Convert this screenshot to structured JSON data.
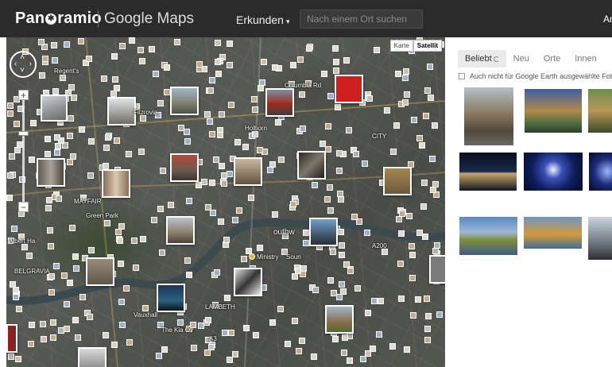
{
  "header": {
    "brand_pre": "Pan",
    "brand_post": "ramio",
    "brand_glyph": "✱",
    "subbrand": "Google Maps",
    "explore_label": "Erkunden",
    "explore_caret": "▾",
    "search_placeholder": "Nach einem Ort suchen",
    "user_stub": "An"
  },
  "map": {
    "type_buttons": [
      "Karte",
      "Satellit"
    ],
    "active_type": "Satellit",
    "zoom_in": "+",
    "zoom_out": "−",
    "pan_glyphs": [
      "‹",
      "›",
      "˄",
      "˅"
    ],
    "labels": [
      "Columbia Rd",
      "Albert Ha",
      "BELGRAVIA",
      "MAYFAIR",
      "outhw",
      "Ministry",
      "Soun",
      "A200",
      "Regent's",
      "CITY",
      "The Kia Ov",
      "A3",
      "Green Park",
      "LAMBETH",
      "Vauxhall",
      "Holborn",
      "Fitzrovia"
    ]
  },
  "panel": {
    "tabs": [
      "Beliebt",
      "Neu",
      "Orte",
      "Innen"
    ],
    "active_tab": "Beliebt",
    "filter_label": "Auch nicht für Google Earth ausgewählte Fotos"
  },
  "colors": {
    "topbar": "#2b2b2b",
    "accent_red": "#cf1f1f"
  }
}
